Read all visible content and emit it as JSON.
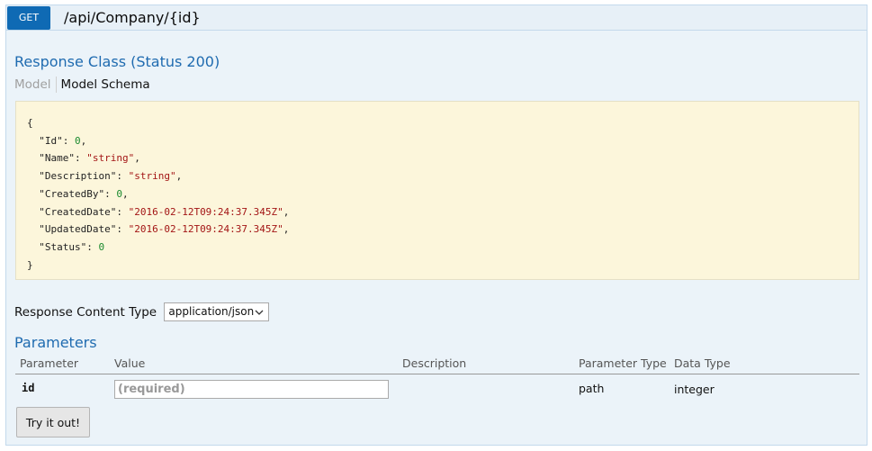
{
  "operation": {
    "method": "GET",
    "path": "/api/Company/{id}"
  },
  "response_class": {
    "title": "Response Class (Status 200)",
    "tabs": [
      {
        "label": "Model",
        "active": false
      },
      {
        "label": "Model Schema",
        "active": true
      }
    ],
    "schema_lines": [
      {
        "text": "{"
      },
      {
        "indent": "  ",
        "key": "\"Id\"",
        "value": "0",
        "type": "num",
        "comma": ","
      },
      {
        "indent": "  ",
        "key": "\"Name\"",
        "value": "\"string\"",
        "type": "str",
        "comma": ","
      },
      {
        "indent": "  ",
        "key": "\"Description\"",
        "value": "\"string\"",
        "type": "str",
        "comma": ","
      },
      {
        "indent": "  ",
        "key": "\"CreatedBy\"",
        "value": "0",
        "type": "num",
        "comma": ","
      },
      {
        "indent": "  ",
        "key": "\"CreatedDate\"",
        "value": "\"2016-02-12T09:24:37.345Z\"",
        "type": "str",
        "comma": ","
      },
      {
        "indent": "  ",
        "key": "\"UpdatedDate\"",
        "value": "\"2016-02-12T09:24:37.345Z\"",
        "type": "str",
        "comma": ","
      },
      {
        "indent": "  ",
        "key": "\"Status\"",
        "value": "0",
        "type": "num",
        "comma": ""
      },
      {
        "text": "}"
      }
    ]
  },
  "response_content_type": {
    "label": "Response Content Type",
    "selected": "application/json"
  },
  "parameters": {
    "title": "Parameters",
    "columns": {
      "parameter": "Parameter",
      "value": "Value",
      "description": "Description",
      "parameter_type": "Parameter Type",
      "data_type": "Data Type"
    },
    "rows": [
      {
        "name": "id",
        "placeholder": "(required)",
        "description": "",
        "parameter_type": "path",
        "data_type": "integer"
      }
    ]
  },
  "actions": {
    "try_label": "Try it out!"
  },
  "colors": {
    "method_get": "#0f6ab4",
    "section_title": "#1f6bb0",
    "schema_bg": "#fcf6db",
    "operation_bg": "#ebf3f9"
  },
  "icons": {
    "select": "chevron-down-icon"
  }
}
